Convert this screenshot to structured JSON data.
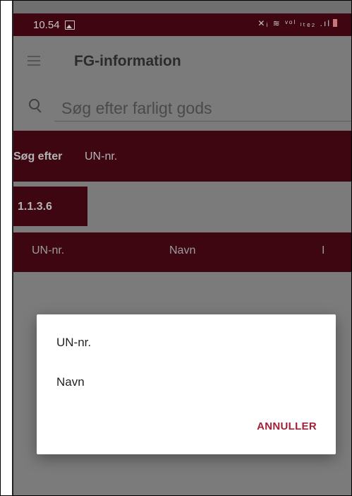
{
  "status_bar": {
    "time": "10.54",
    "right_icons_text": "✕ᵢ ≋ ᵛᵒˡ ₗₜₑ₂ .ıl"
  },
  "app_bar": {
    "title": "FG-information"
  },
  "search": {
    "placeholder": "Søg efter farligt gods",
    "value": ""
  },
  "search_by": {
    "label": "Søg efter",
    "value": "UN-nr."
  },
  "filter": {
    "chip_label": "1.1.3.6"
  },
  "table": {
    "columns": [
      "UN-nr.",
      "Navn",
      "I"
    ]
  },
  "dialog": {
    "options": [
      "UN-nr.",
      "Navn"
    ],
    "cancel_label": "ANNULLER"
  },
  "colors": {
    "accent": "#3d0611",
    "cancel_text": "#a3203a",
    "scrim": "#7b7b7b"
  }
}
